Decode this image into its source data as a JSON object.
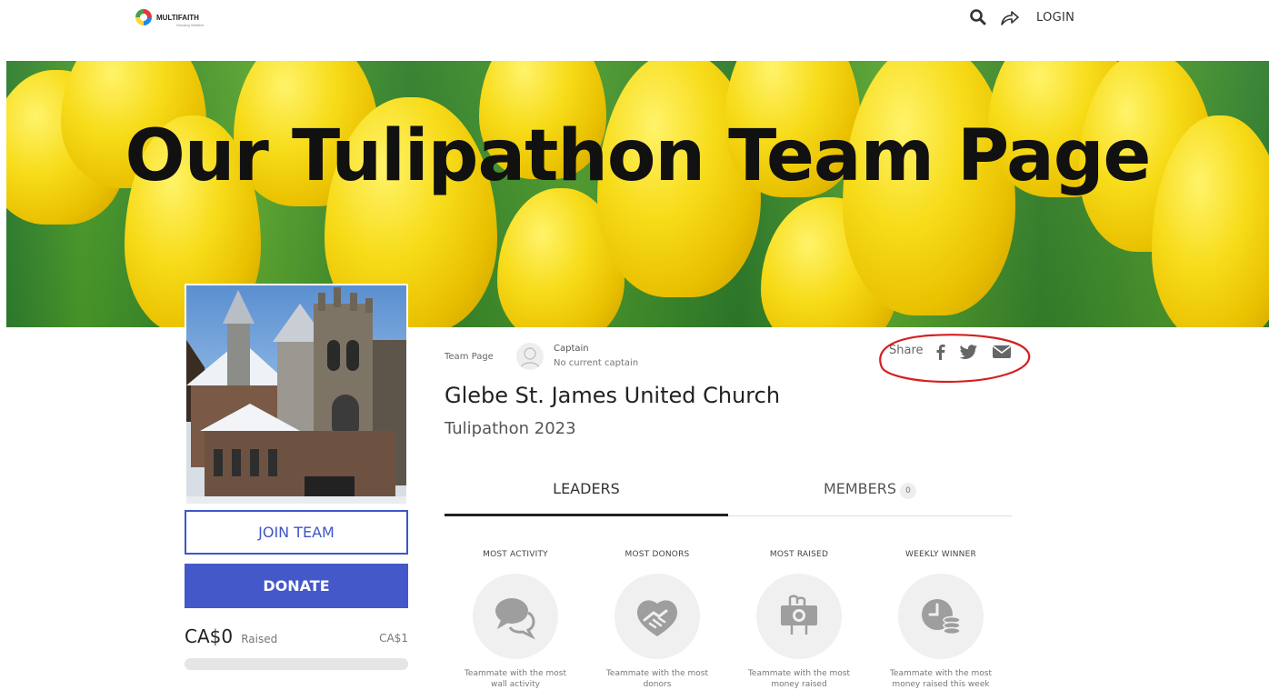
{
  "header": {
    "logo_text": "MULTIFAITH",
    "logo_subtext": "Housing Initiative",
    "login_label": "LOGIN",
    "icons": [
      "search-icon",
      "share-arrow-icon"
    ]
  },
  "banner": {
    "title": "Our Tulipathon Team Page"
  },
  "sidebar": {
    "join_label": "JOIN TEAM",
    "donate_label": "DONATE",
    "raised_amount": "CA$0",
    "raised_label": "Raised",
    "goal_amount": "CA$1",
    "progress": 0
  },
  "team": {
    "page_type": "Team Page",
    "captain_title": "Captain",
    "captain_value": "No current captain",
    "share_label": "Share",
    "share_icons": [
      "facebook-icon",
      "twitter-icon",
      "email-icon"
    ],
    "name": "Glebe St. James United Church",
    "campaign": "Tulipathon 2023"
  },
  "tabs": {
    "leaders_label": "LEADERS",
    "members_label": "MEMBERS",
    "members_count": "0"
  },
  "leaders": [
    {
      "title": "MOST ACTIVITY",
      "desc_line1": "Teammate with the most",
      "desc_line2": "wall activity",
      "icon": "chat-bubbles-icon"
    },
    {
      "title": "MOST DONORS",
      "desc_line1": "Teammate with the most",
      "desc_line2": "donors",
      "icon": "handshake-icon"
    },
    {
      "title": "MOST RAISED",
      "desc_line1": "Teammate with the most",
      "desc_line2": "money raised",
      "icon": "money-hand-icon"
    },
    {
      "title": "WEEKLY WINNER",
      "desc_line1": "Teammate with the most",
      "desc_line2": "money raised this week",
      "icon": "clock-coins-icon"
    }
  ],
  "colors": {
    "accent": "#4458c9",
    "annotation": "#d42020"
  }
}
